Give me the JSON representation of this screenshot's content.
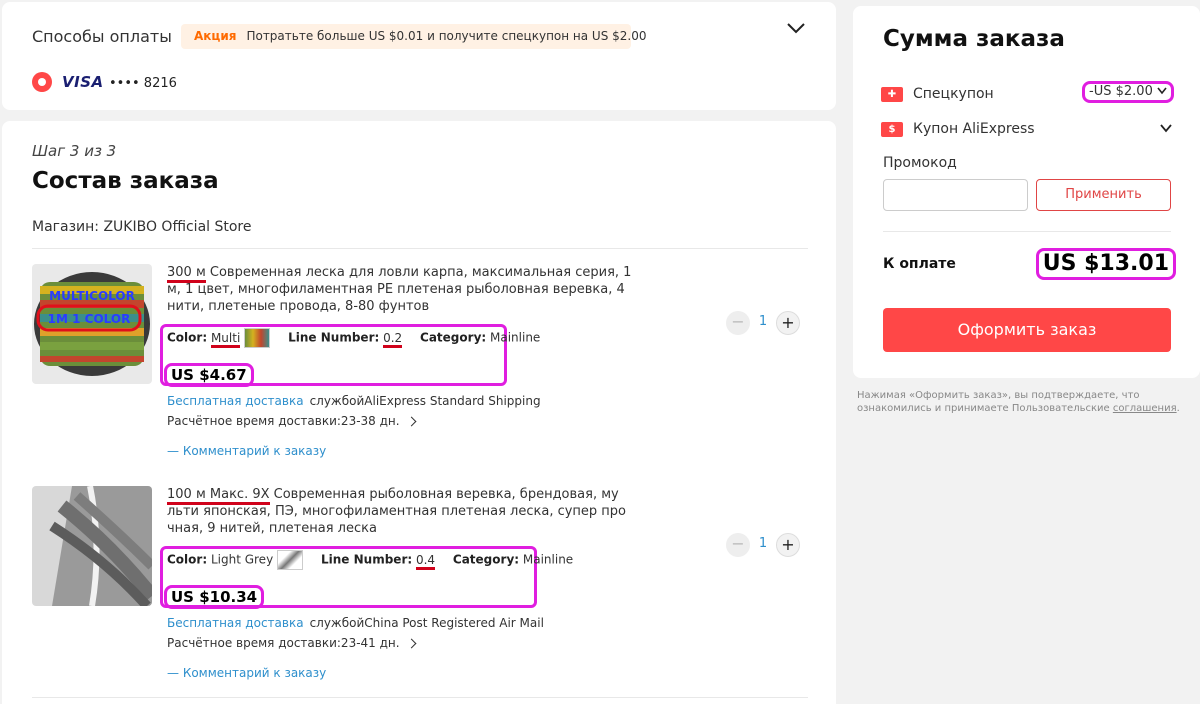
{
  "payment": {
    "title": "Способы оплаты",
    "promo_tag": "Акция",
    "promo_text": "Потратьте больше US $0.01 и получите спецкупон на US $2.00",
    "card_brand": "VISA",
    "card_mask": "•••• 8216"
  },
  "order": {
    "step": "Шаг 3 из 3",
    "title": "Состав заказа",
    "store": "Магазин: ZUKIBO Official Store",
    "items": [
      {
        "name_highlight": "300 м",
        "name_rest": " Современная леска для ловли карпа, максимальная серия, 1 м, 1 цвет, многофиламентная PE плетеная рыболовная веревка, 4 нити, плетеные провода, 8-80 фунтов",
        "thumb_text_1": "MULTICOLOR",
        "thumb_text_2": "1M 1 COLOR",
        "color_label": "Color:",
        "color_value": "Multi",
        "line_label": "Line Number:",
        "line_value": "0.2",
        "category_label": "Category:",
        "category_value": "Mainline",
        "price": "US $4.67",
        "free_shipping": "Бесплатная доставка",
        "shipping_method": "службойAliExpress Standard Shipping",
        "delivery_time": "Расчётное время доставки:23-38 дн.",
        "comment": "— Комментарий к заказу",
        "qty": "1"
      },
      {
        "name_highlight": "100 м Макс. 9X",
        "name_rest": " Современная рыболовная веревка, брендовая, му льти японская, ПЭ, многофиламентная плетеная леска, супер про чная, 9 нитей, плетеная леска",
        "color_label": "Color:",
        "color_value": "Light Grey",
        "line_label": "Line Number:",
        "line_value": "0.4",
        "category_label": "Category:",
        "category_value": "Mainline",
        "price": "US $10.34",
        "free_shipping": "Бесплатная доставка",
        "shipping_method": "службойChina Post Registered Air Mail",
        "delivery_time": "Расчётное время доставки:23-41 дн.",
        "comment": "— Комментарий к заказу",
        "qty": "1"
      }
    ]
  },
  "summary": {
    "title": "Сумма заказа",
    "special_coupon_label": "Спецкупон",
    "special_coupon_value": "-US $2.00",
    "ali_coupon_label": "Купон AliExpress",
    "promo_label": "Промокод",
    "promo_placeholder": "",
    "apply_button": "Применить",
    "total_label": "К оплате",
    "total_value": "US $13.01",
    "checkout_button": "Оформить заказ"
  },
  "legal": {
    "text": "Нажимая «Оформить заказ», вы подтверждаете, что ознакомились и принимаете Пользовательские ",
    "link": "соглашения",
    "end": "."
  },
  "colors": {
    "accent_red": "#ff4747",
    "link_blue": "#2e8fcc",
    "highlight_magenta": "#e01ee0",
    "promo_orange": "#ff6a00"
  }
}
